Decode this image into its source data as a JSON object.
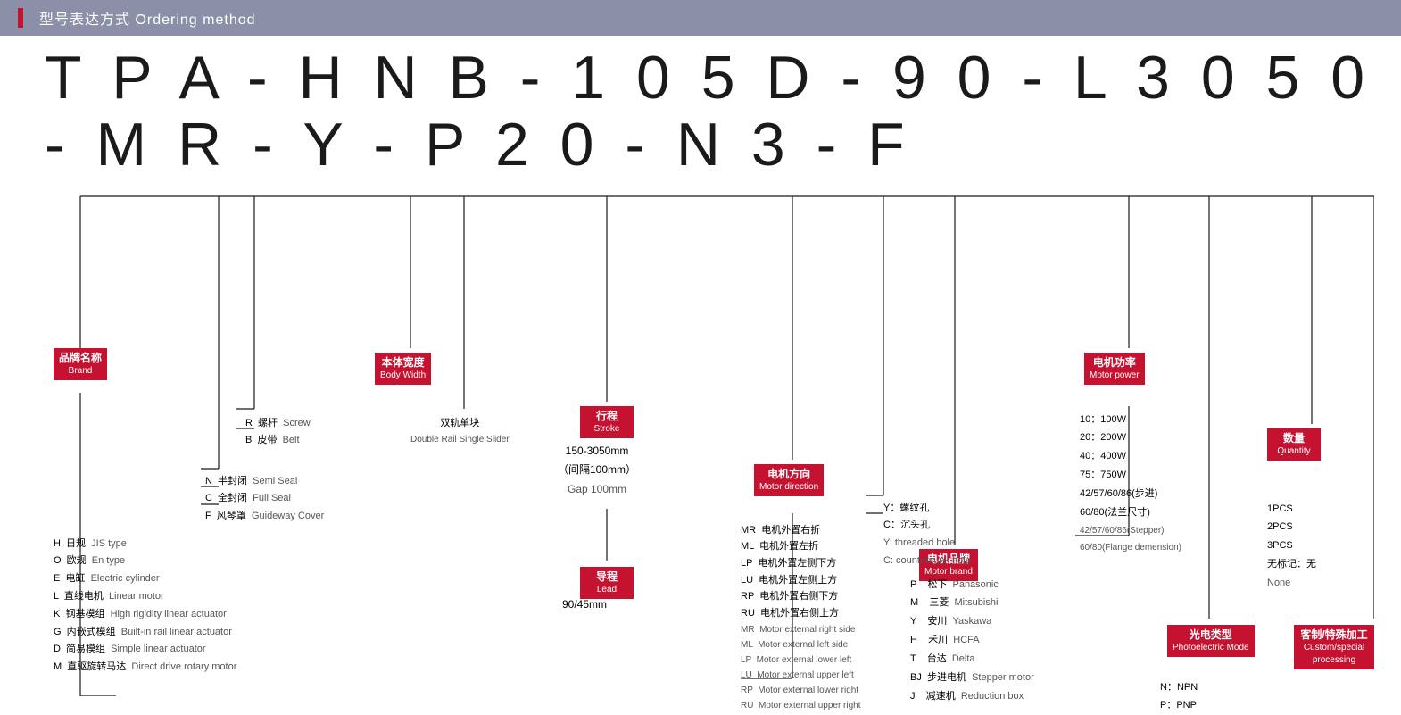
{
  "header": {
    "title": "型号表达方式 Ordering method",
    "accent_color": "#c41230",
    "bar_color": "#8b8fa8"
  },
  "model_number": "T P A - H N B - 1 0 5 D - 9 0 - L 3 0 5 0 - M R - Y - P 2 0 - N 3 - F",
  "labels": {
    "brand": {
      "zh": "品牌名称",
      "en": "Brand"
    },
    "body_width": {
      "zh": "本体宽度",
      "en": "Body Width"
    },
    "stroke": {
      "zh": "行程",
      "en": "Stroke"
    },
    "lead": {
      "zh": "导程",
      "en": "Lead"
    },
    "motor_direction": {
      "zh": "电机方向",
      "en": "Motor direction"
    },
    "motor_power": {
      "zh": "电机功率",
      "en": "Motor power"
    },
    "motor_brand": {
      "zh": "电机品牌",
      "en": "Motor brand"
    },
    "quantity": {
      "zh": "数量",
      "en": "Quantity"
    },
    "photoelectric": {
      "zh": "光电类型",
      "en": "Photoelectric Mode"
    },
    "custom": {
      "zh": "客制/特殊加工",
      "en": "Custom/special processing"
    }
  },
  "brand_types": [
    "H  日规  JIS type",
    "O  欧规  En type",
    "E  电缸  Electric cylinder",
    "L  直线电机  Linear motor",
    "K  钢基模组  High rigidity linear actuator",
    "G  内嵌式模组  Built-in rail linear actuator",
    "D  简易模组  Simple linear actuator",
    "M  直驱旋转马达  Direct drive rotary motor"
  ],
  "seal_types": [
    "N  半封闭  Semi Seal",
    "C  全封闭  Full Seal",
    "F  风琴罩  Guideway Cover"
  ],
  "drive_types": [
    "R  螺杆  Screw",
    "B  皮带  Belt"
  ],
  "body_sub": {
    "label": "双轨单块",
    "sublabel": "Double Rail Single Slider"
  },
  "stroke_val": {
    "range": "150-3050mm",
    "gap": "（间隔100mm）",
    "gap_en": "Gap 100mm"
  },
  "lead_val": "90/45mm",
  "motor_dir_vals": [
    "MR  电机外置右折",
    "ML  电机外置左折",
    "LP  电机外置左侧下方",
    "LU  电机外置左侧上方",
    "RP  电机外置右侧下方",
    "RU  电机外置右侧上方",
    "MR  Motor external right side",
    "ML  Motor external left side",
    "LP  Motor external lower left",
    "LU  Motor external upper left",
    "RP  Motor external lower right",
    "RU  Motor external upper right"
  ],
  "hole_type": [
    "Y：螺纹孔",
    "C：沉头孔",
    "Y: threaded hole",
    "C: countersunk hole"
  ],
  "motor_brand_vals": [
    "P    松下  Panasonic",
    "M    三菱  Mitsubishi",
    "Y    安川  Yaskawa",
    "H    禾川  HCFA",
    "T    台达  Delta",
    "BJ  步进电机  Stepper motor",
    "J    减速机  Reduction box"
  ],
  "motor_power_vals": [
    "10：100W",
    "20：200W",
    "40：400W",
    "75：750W",
    "42/57/60/86(步进)",
    "60/80(法兰尺寸)",
    "42/57/60/86(Stepper)",
    "60/80(Flange demension)"
  ],
  "quantity_vals": [
    "1PCS",
    "2PCS",
    "3PCS",
    "无标记：无",
    "None"
  ],
  "photo_vals": [
    "N：NPN",
    "P：PNP"
  ]
}
